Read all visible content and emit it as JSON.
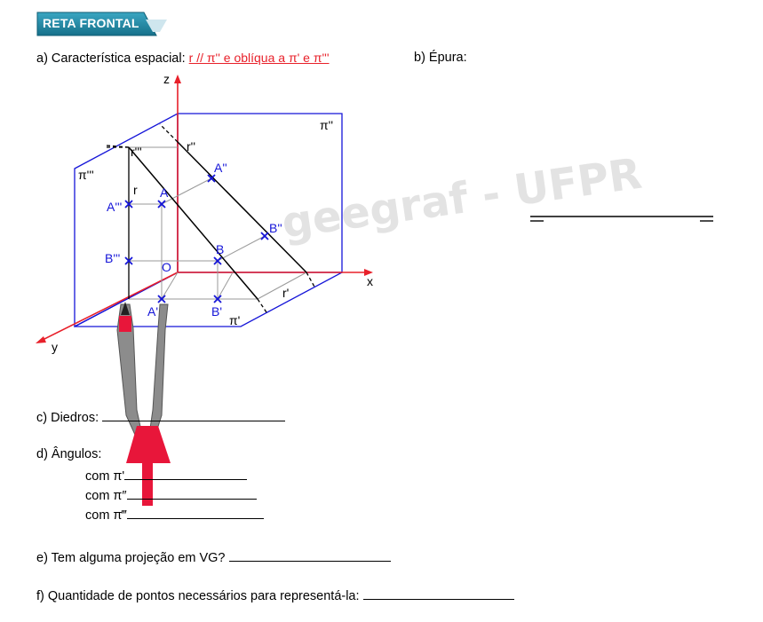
{
  "header": {
    "title": "RETA FRONTAL"
  },
  "watermark": "geegraf - UFPR",
  "questions": {
    "a_label": "a) Característica espacial:",
    "a_answer": "r // π'' e oblíqua a π' e π'''",
    "b_label": "b) Épura:",
    "c_label": "c) Diedros:",
    "d_label": "d) Ângulos:",
    "d_with1": "com π'",
    "d_with2": "com π″",
    "d_with3": "com π‴",
    "e_label": "e) Tem alguma projeção em VG?",
    "f_label": "f) Quantidade de pontos necessários para representá-la:"
  },
  "diagram": {
    "z": "z",
    "x": "x",
    "y": "y",
    "origin": "O",
    "plane_front": "π''",
    "plane_side": "π'''",
    "plane_horizontal": "π'",
    "r_front": "r''",
    "r_side": "r'''",
    "r_horizontal": "r'",
    "r": "r",
    "A": "A",
    "B": "B",
    "A_front": "A''",
    "B_front": "B''",
    "A_side": "A'''",
    "B_side": "B'''",
    "A_horizontal": "A'",
    "B_horizontal": "B'"
  },
  "colors": {
    "plane_blue": "#1515d8",
    "axis_red": "#e8202a",
    "answer_red": "#e8202a",
    "banner_teal": "#1d7f9a",
    "compass_gray": "#8c8c8c"
  }
}
